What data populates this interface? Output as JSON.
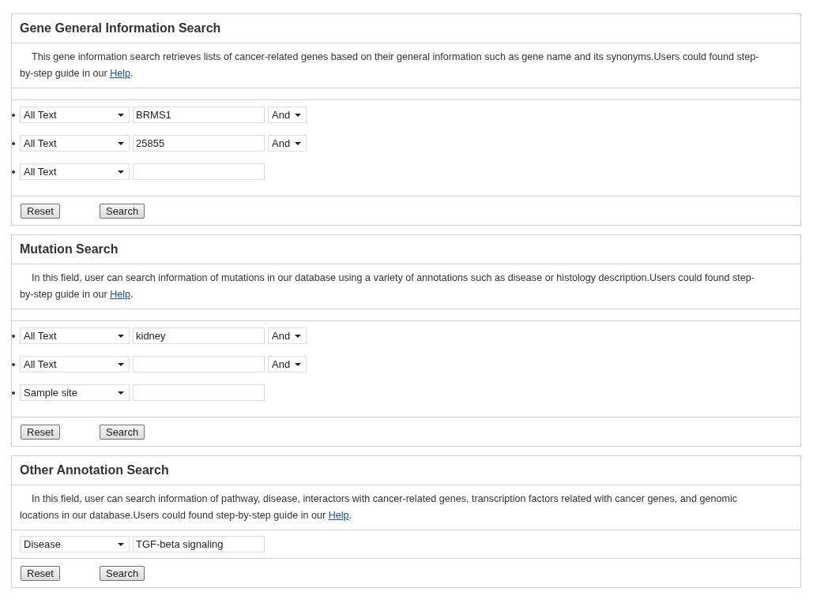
{
  "sections": [
    {
      "title": "Gene General Information Search",
      "description": {
        "text": "This gene information search retrieves lists of cancer-related genes based on their general information such as gene name and its synonyms.Users could found step-by-step guide in our ",
        "link": "Help",
        "after": "."
      },
      "bulleted": true,
      "rows": [
        {
          "field": "All Text",
          "value": "BRMS1",
          "operator": "And"
        },
        {
          "field": "All Text",
          "value": "25855",
          "operator": "And"
        },
        {
          "field": "All Text"
        }
      ],
      "buttons": [
        "Reset",
        "Search"
      ]
    },
    {
      "title": "Mutation Search",
      "description": {
        "text": "In this field, user can search information of mutations in our database using a variety of annotations such as disease or histology description.Users could found step-by-step guide in our ",
        "link": "Help",
        "after": "."
      },
      "bulleted": true,
      "rows": [
        {
          "field": "All Text",
          "value": "kidney",
          "operator": "And"
        },
        {
          "field": "All Text",
          "operator": "And"
        },
        {
          "field": "Sample site"
        }
      ],
      "buttons": [
        "Reset",
        "Search"
      ]
    },
    {
      "title": "Other Annotation Search",
      "description": {
        "text": "In this field, user can search information of pathway, disease, interactors with cancer-related genes, transcription factors related with cancer genes, and genomic locations in our database.Users could found step-by-step guide in our ",
        "link": "Help",
        "after": "."
      },
      "bulleted": false,
      "rows": [
        {
          "field": "Disease",
          "value": "TGF-beta signaling"
        }
      ],
      "buttons": [
        "Reset",
        "Search"
      ]
    }
  ]
}
